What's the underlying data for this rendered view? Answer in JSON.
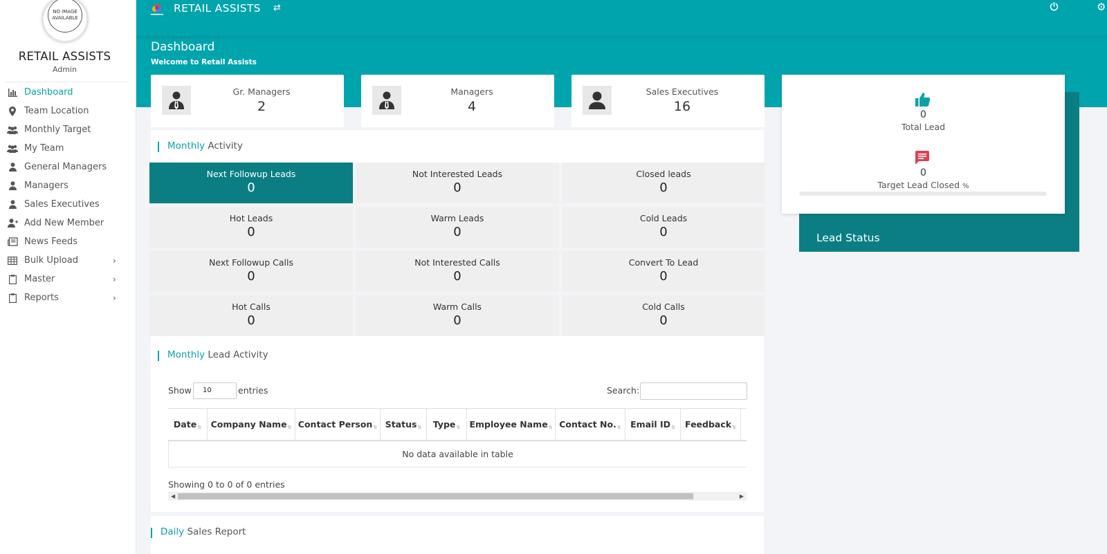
{
  "app": {
    "title": "RETAIL ASSISTS",
    "avatar_text": "NO IMAGE AVAILABLE",
    "brand": "RETAIL ASSISTS",
    "role": "Admin",
    "accent": "#00a4ad",
    "dark_accent": "#0b7e83"
  },
  "sidebar": {
    "items": [
      {
        "label": "Dashboard",
        "icon": "bar-chart-icon",
        "active": true
      },
      {
        "label": "Team Location",
        "icon": "map-pin-icon"
      },
      {
        "label": "Monthly Target",
        "icon": "users-icon"
      },
      {
        "label": "My Team",
        "icon": "users-icon"
      },
      {
        "label": "General Managers",
        "icon": "user-icon"
      },
      {
        "label": "Managers",
        "icon": "user-icon"
      },
      {
        "label": "Sales Executives",
        "icon": "user-icon"
      },
      {
        "label": "Add New Member",
        "icon": "user-plus-icon"
      },
      {
        "label": "News Feeds",
        "icon": "newspaper-icon"
      },
      {
        "label": "Bulk Upload",
        "icon": "table-icon",
        "expandable": true
      },
      {
        "label": "Master",
        "icon": "clipboard-icon",
        "expandable": true
      },
      {
        "label": "Reports",
        "icon": "clipboard-icon",
        "expandable": true
      }
    ]
  },
  "header": {
    "page_title": "Dashboard",
    "subtitle": "Welcome to Retail Assists"
  },
  "stats": [
    {
      "label": "Gr. Managers",
      "value": "2"
    },
    {
      "label": "Managers",
      "value": "4"
    },
    {
      "label": "Sales Executives",
      "value": "16"
    }
  ],
  "monthly_activity": {
    "title_highlight": "Monthly",
    "title_rest": " Activity",
    "tiles": [
      {
        "label": "Next Followup Leads",
        "value": "0"
      },
      {
        "label": "Not Interested Leads",
        "value": "0"
      },
      {
        "label": "Closed leads",
        "value": "0"
      },
      {
        "label": "Hot Leads",
        "value": "0"
      },
      {
        "label": "Warm Leads",
        "value": "0"
      },
      {
        "label": "Cold Leads",
        "value": "0"
      },
      {
        "label": "Next Followup Calls",
        "value": "0"
      },
      {
        "label": "Not Interested Calls",
        "value": "0"
      },
      {
        "label": "Convert To Lead",
        "value": "0"
      },
      {
        "label": "Hot Calls",
        "value": "0"
      },
      {
        "label": "Warm Calls",
        "value": "0"
      },
      {
        "label": "Cold Calls",
        "value": "0"
      }
    ]
  },
  "lead_activity": {
    "title_highlight": "Monthly",
    "title_rest": " Lead Activity",
    "show_label": "Show",
    "entries_label": "entries",
    "page_length": "10",
    "search_label": "Search:",
    "columns": [
      "Date",
      "Company Name",
      "Contact Person",
      "Status",
      "Type",
      "Employee Name",
      "Contact No.",
      "Email ID",
      "Feedback"
    ],
    "empty_message": "No data available in table",
    "info": "Showing 0 to 0 of 0 entries"
  },
  "daily_sales": {
    "title_highlight": "Daily",
    "title_rest": " Sales Report"
  },
  "lead_summary": {
    "total_value": "0",
    "total_label": "Total Lead",
    "closed_value": "0",
    "closed_label": "Target Lead Closed",
    "closed_unit": "%",
    "progress": 0,
    "status_title": "Lead Status"
  }
}
